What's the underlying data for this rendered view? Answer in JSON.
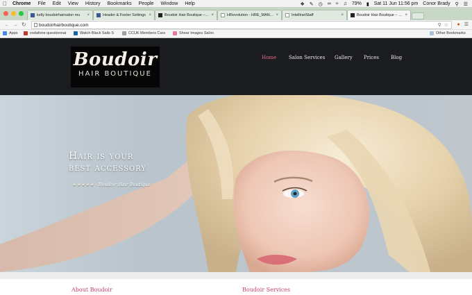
{
  "menubar": {
    "app": "Chrome",
    "items": [
      "File",
      "Edit",
      "View",
      "History",
      "Bookmarks",
      "People",
      "Window",
      "Help"
    ],
    "battery": "79%",
    "clock": "Sat 11 Jun  11:56 pm",
    "user": "Conor Brady"
  },
  "tabs": [
    {
      "title": "kelly boudoirhairsalon mu",
      "color": "#3b5998"
    },
    {
      "title": "Header & Footer Settings",
      "color": "#3b5998"
    },
    {
      "title": "Boudoir Hair Boutique – Bo",
      "color": "#222222"
    },
    {
      "title": "HRevolution - HRE_MANCH",
      "color": "#777777"
    },
    {
      "title": "IntellinetStaff",
      "color": "#999999"
    },
    {
      "title": "Boudoir Hair Boutique – Bo",
      "color": "#222222"
    }
  ],
  "toolbar": {
    "url": "boudoirhairboutique.com"
  },
  "bookmarks": {
    "items": [
      {
        "label": "Apps",
        "color": "#4a86e8"
      },
      {
        "label": "vodafone questionnai",
        "color": "#c0392b"
      },
      {
        "label": "Watch Black Sails S",
        "color": "#1f5fa5"
      },
      {
        "label": "CCUK Members Cars",
        "color": "#9aa0a6"
      },
      {
        "label": "Shear Images Salon",
        "color": "#e57a96"
      }
    ],
    "other": "Other Bookmarks"
  },
  "site": {
    "logo_main": "Boudoir",
    "logo_sub": "HAIR BOUTIQUE",
    "nav": [
      "Home",
      "Salon Services",
      "Gallery",
      "Prices",
      "Blog"
    ],
    "accent": "#e26a86",
    "hero_line1": "Hair is your",
    "hero_line2": "best accessory",
    "hero_stars": "★★★★★",
    "hero_caption": "- Boudoir Hair Boutique",
    "section_left": "About Boudoir",
    "section_right": "Boudoir Services"
  }
}
